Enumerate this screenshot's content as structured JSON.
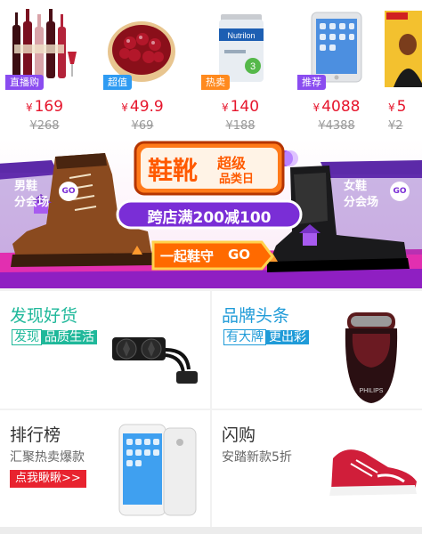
{
  "products": [
    {
      "tag": "直播购",
      "tag_color": "#8a4cf0",
      "price": "169",
      "currency": "¥",
      "original": "¥268",
      "icon": "wine-bottles-icon"
    },
    {
      "tag": "超值",
      "tag_color": "#2f9bf2",
      "price": "49.9",
      "currency": "¥",
      "original": "¥69",
      "icon": "cherries-icon"
    },
    {
      "tag": "热卖",
      "tag_color": "#ff8a1e",
      "price": "140",
      "currency": "¥",
      "original": "¥188",
      "icon": "milk-powder-can-icon"
    },
    {
      "tag": "推荐",
      "tag_color": "#8a4cf0",
      "price": "4088",
      "currency": "¥",
      "original": "¥4388",
      "icon": "tablet-icon"
    },
    {
      "tag": "",
      "tag_color": "#8a4cf0",
      "price": "5",
      "currency": "¥",
      "original": "¥2",
      "icon": "magazine-icon"
    }
  ],
  "banner": {
    "left_badge": [
      "男鞋",
      "分会场"
    ],
    "right_badge": [
      "女鞋",
      "分会场"
    ],
    "go_label": "GO",
    "title_main": "鞋靴",
    "title_small_1": "超级",
    "title_small_2": "品类日",
    "promo": "跨店满200减100",
    "button_text": "一起鞋守",
    "button_go": "GO",
    "colors": {
      "purple": "#7a2ed6",
      "orange": "#ff6a00",
      "pink": "#f23bb0"
    }
  },
  "sections": {
    "discover": {
      "title": "发现好货",
      "sub_a": "发现",
      "sub_b": "品质生活",
      "title_color": "#1fb89a",
      "icon": "cpu-water-cooler-icon"
    },
    "brand": {
      "title": "品牌头条",
      "sub_a": "有大牌",
      "sub_b": "更出彩",
      "title_color": "#1f9bd8",
      "icon": "electric-shaver-icon",
      "logo_text": "PHILIPS"
    },
    "ranking": {
      "title": "排行榜",
      "sub": "汇聚热卖爆款",
      "cta": "点我瞅瞅>>",
      "icon": "smartphone-icon"
    },
    "flash": {
      "title": "闪购",
      "sub": "安踏新款5折",
      "icon": "running-shoe-icon"
    }
  }
}
